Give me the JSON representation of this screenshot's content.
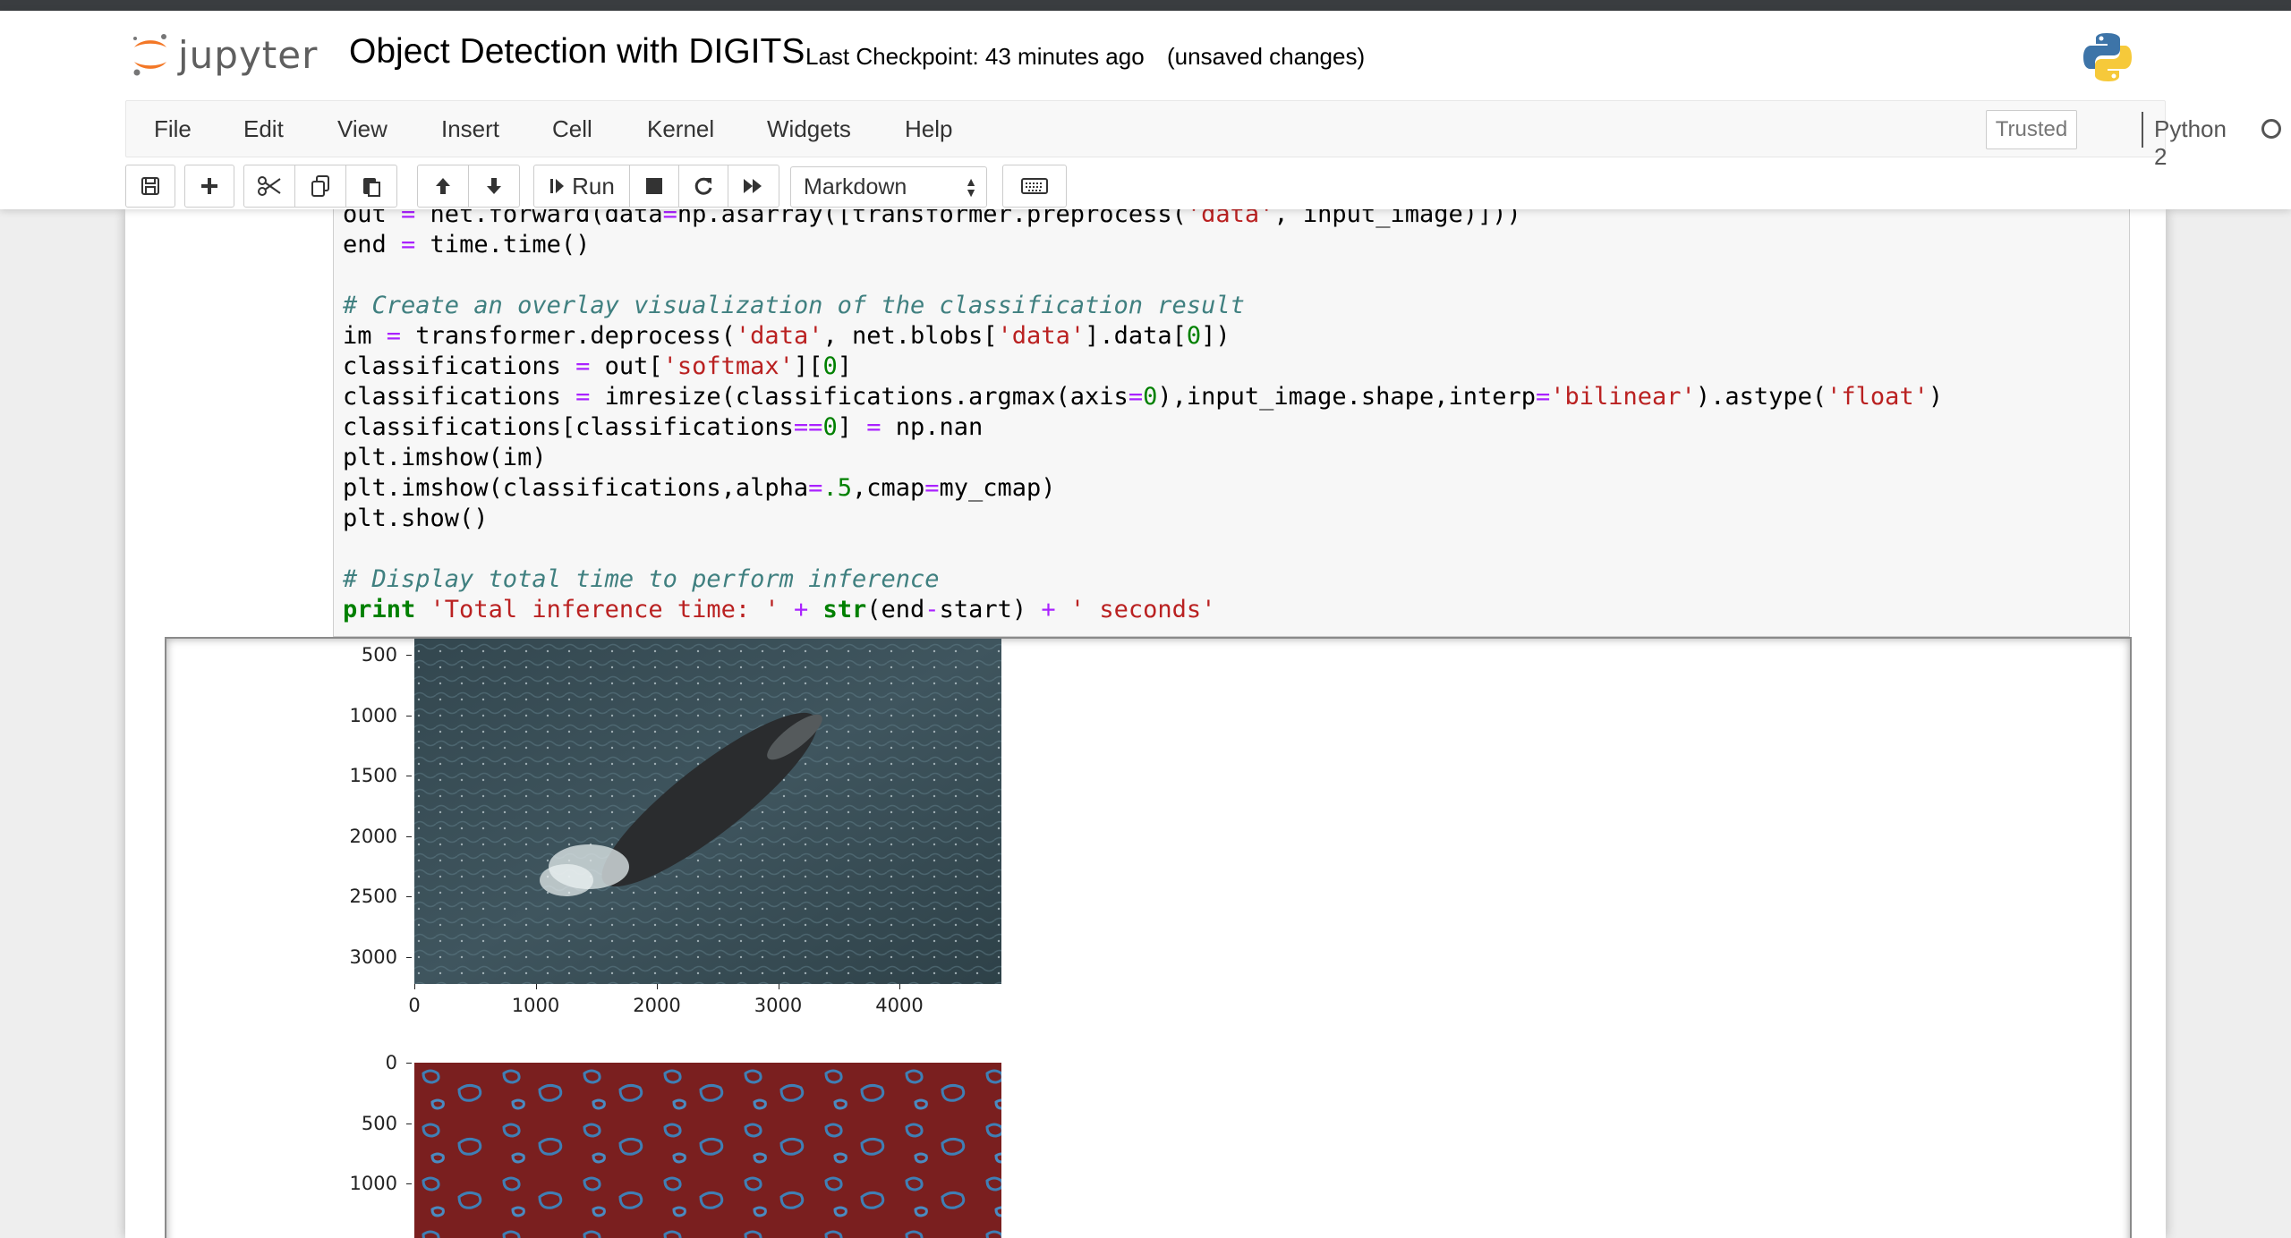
{
  "header": {
    "logo_text": "jupyter",
    "notebook_title": "Object Detection with DIGITS",
    "checkpoint": "Last Checkpoint: 43 minutes ago",
    "unsaved": "(unsaved changes)"
  },
  "menu": {
    "items": [
      "File",
      "Edit",
      "View",
      "Insert",
      "Cell",
      "Kernel",
      "Widgets",
      "Help"
    ],
    "trusted": "Trusted",
    "kernel": "Python 2"
  },
  "toolbar": {
    "run_label": "Run",
    "cell_type": "Markdown",
    "icons": [
      "save-icon",
      "plus-icon",
      "cut-icon",
      "copy-icon",
      "paste-icon",
      "arrow-up-icon",
      "arrow-down-icon",
      "run-icon",
      "stop-icon",
      "restart-icon",
      "fast-forward-icon",
      "keyboard-icon"
    ]
  },
  "code": {
    "lines": [
      "out = net.forward(data=np.asarray([transformer.preprocess('data', input_image)]))",
      "end = time.time()",
      "",
      "# Create an overlay visualization of the classification result",
      "im = transformer.deprocess('data', net.blobs['data'].data[0])",
      "classifications = out['softmax'][0]",
      "classifications = imresize(classifications.argmax(axis=0),input_image.shape,interp='bilinear').astype('float')",
      "classifications[classifications==0] = np.nan",
      "plt.imshow(im)",
      "plt.imshow(classifications,alpha=.5,cmap=my_cmap)",
      "plt.show()",
      "",
      "# Display total time to perform inference",
      "print 'Total inference time: ' + str(end-start) + ' seconds'"
    ]
  },
  "output": {
    "plot1": {
      "y_ticks": [
        "500",
        "1000",
        "1500",
        "2000",
        "2500",
        "3000"
      ],
      "x_ticks": [
        "0",
        "1000",
        "2000",
        "3000",
        "4000"
      ]
    },
    "plot2": {
      "y_ticks": [
        "0",
        "500",
        "1000"
      ]
    }
  },
  "colors": {
    "water": "#3c525c",
    "overlay_red": "#7a1f1f",
    "overlay_blue": "#2f5f8f"
  }
}
